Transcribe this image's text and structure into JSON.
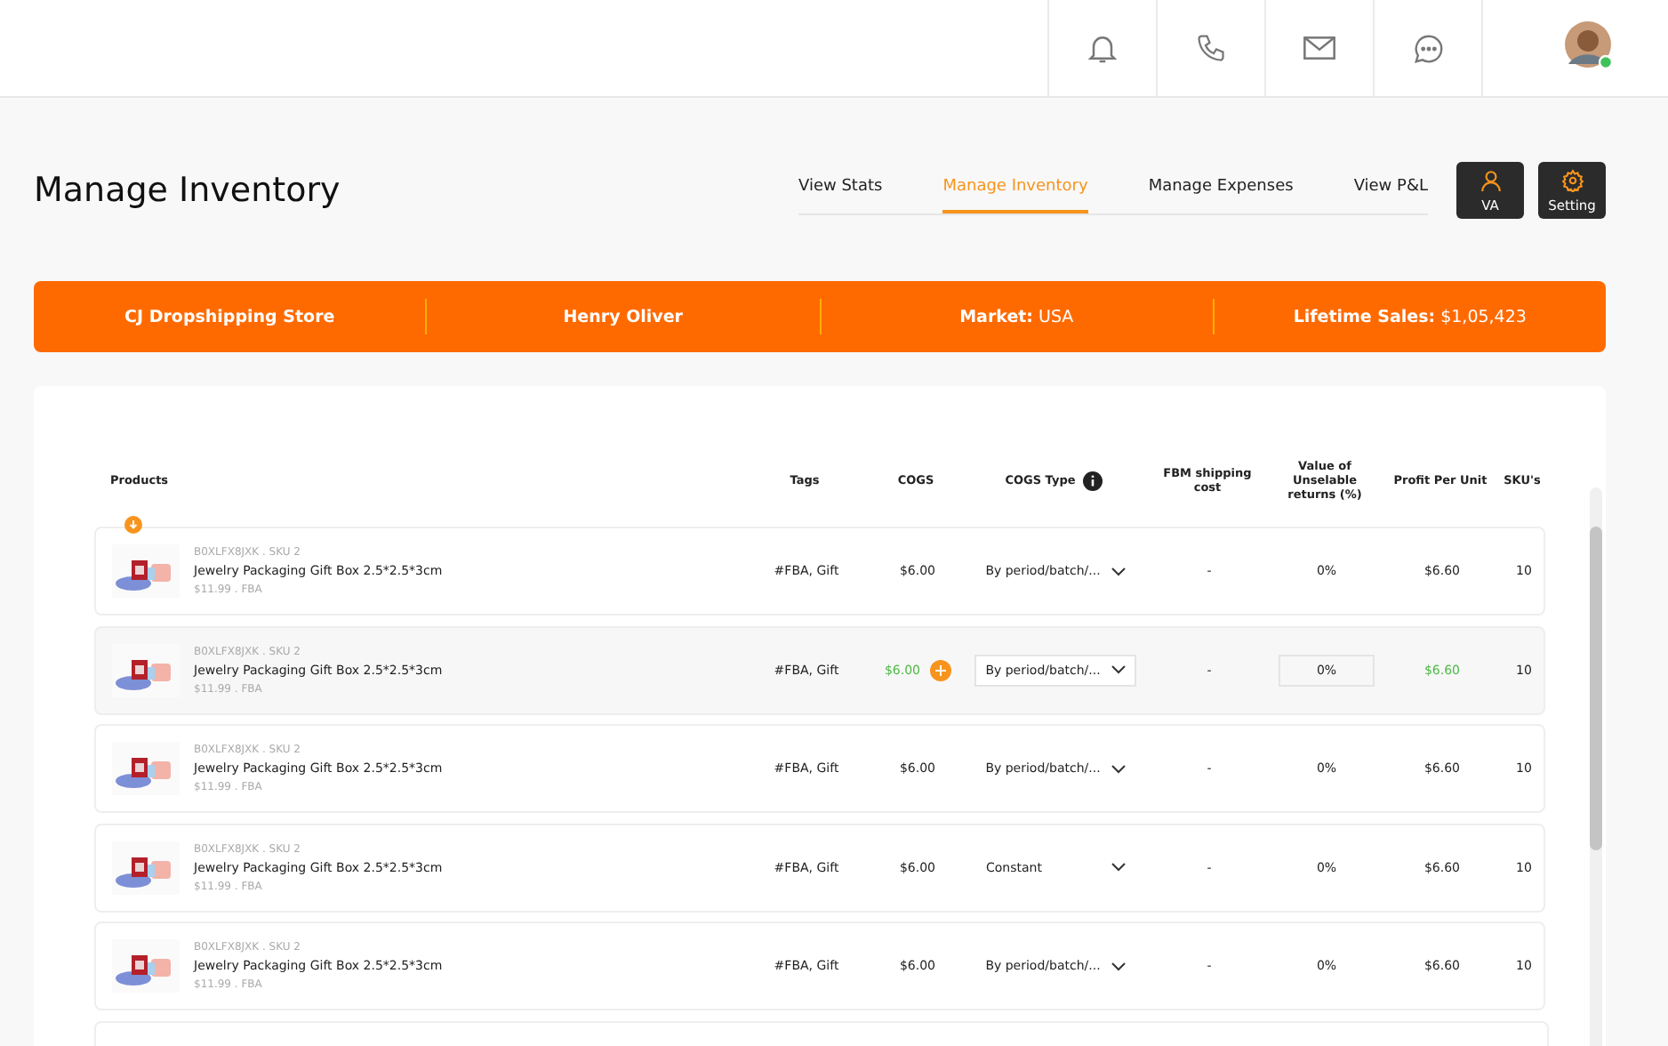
{
  "page_title": "Manage Inventory",
  "tabs": [
    {
      "label": "View Stats",
      "selected": false
    },
    {
      "label": "Manage Inventory",
      "selected": true
    },
    {
      "label": "Manage Expenses",
      "selected": false
    },
    {
      "label": "View P&L",
      "selected": false
    }
  ],
  "action_buttons": [
    {
      "label": "VA",
      "kind": "person"
    },
    {
      "label": "Setting",
      "kind": "gear"
    }
  ],
  "banner": [
    "**CJ Dropshipping Store**",
    "**Henry Oliver**",
    "**Market:** USA",
    "**Lifetime Sales:** $1,05,423"
  ],
  "table": {
    "columns": [
      "Products",
      "Tags",
      "COGS",
      "COGS Type",
      "FBM shipping cost",
      "Value of Unselable returns (%)",
      "Profit Per Unit",
      "SKU's"
    ],
    "rows": [
      {
        "sku_line": "B0XLFX8JXK . SKU 2",
        "name": "Jewelry Packaging Gift Box 2.5*2.5*3cm",
        "price_line": "$11.99 . FBA",
        "tags": "#FBA, Gift",
        "cogs": "$6.00",
        "cogs_type": "By period/batch/...",
        "fbm": "-",
        "returns": "0%",
        "profit": "$6.60",
        "skus": "10",
        "selected": false,
        "flagged": true
      },
      {
        "sku_line": "B0XLFX8JXK . SKU 2",
        "name": "Jewelry Packaging Gift Box 2.5*2.5*3cm",
        "price_line": "$11.99 . FBA",
        "tags": "#FBA, Gift",
        "cogs": "$6.00",
        "cogs_type": "By period/batch/...",
        "fbm": "-",
        "returns": "0%",
        "profit": "$6.60",
        "skus": "10",
        "selected": true,
        "flagged": false
      },
      {
        "sku_line": "B0XLFX8JXK . SKU 2",
        "name": "Jewelry Packaging Gift Box 2.5*2.5*3cm",
        "price_line": "$11.99 . FBA",
        "tags": "#FBA, Gift",
        "cogs": "$6.00",
        "cogs_type": "By period/batch/...",
        "fbm": "-",
        "returns": "0%",
        "profit": "$6.60",
        "skus": "10",
        "selected": false,
        "flagged": false
      },
      {
        "sku_line": "B0XLFX8JXK . SKU 2",
        "name": "Jewelry Packaging Gift Box 2.5*2.5*3cm",
        "price_line": "$11.99 . FBA",
        "tags": "#FBA, Gift",
        "cogs": "$6.00",
        "cogs_type": "Constant",
        "fbm": "-",
        "returns": "0%",
        "profit": "$6.60",
        "skus": "10",
        "selected": false,
        "flagged": false
      },
      {
        "sku_line": "B0XLFX8JXK . SKU 2",
        "name": "Jewelry Packaging Gift Box 2.5*2.5*3cm",
        "price_line": "$11.99 . FBA",
        "tags": "#FBA, Gift",
        "cogs": "$6.00",
        "cogs_type": "By period/batch/...",
        "fbm": "-",
        "returns": "0%",
        "profit": "$6.60",
        "skus": "10",
        "selected": false,
        "flagged": false
      }
    ]
  }
}
